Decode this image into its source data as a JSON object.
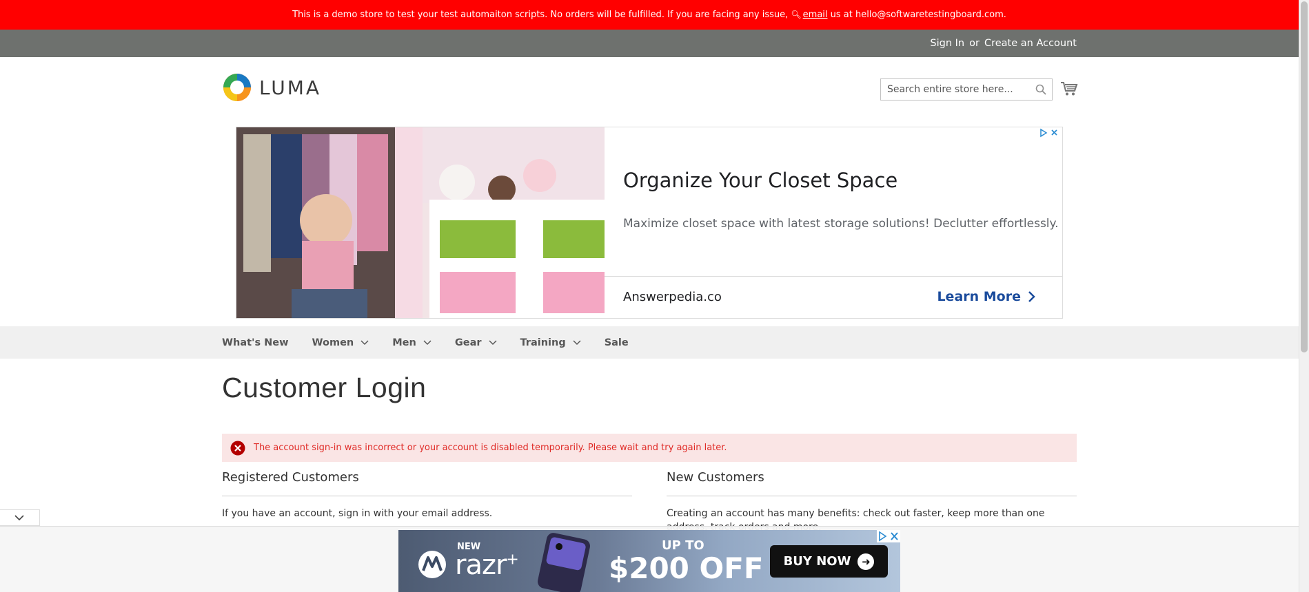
{
  "demo_notice": {
    "text_before": "This is a demo store to test your test automaiton scripts. No orders will be fulfilled. If you are facing any issue, ",
    "email_link": "email",
    "text_after": " us at hello@softwaretestingboard.com."
  },
  "header_links": {
    "sign_in": "Sign In",
    "or": "or",
    "create_account": "Create an Account"
  },
  "logo_text": "LUMA",
  "search": {
    "placeholder": "Search entire store here..."
  },
  "ad": {
    "title": "Organize Your Closet Space",
    "description": "Maximize closet space with latest storage solutions! Declutter effortlessly.",
    "domain": "Answerpedia.co",
    "cta": "Learn More"
  },
  "nav": {
    "whats_new": "What's New",
    "women": "Women",
    "men": "Men",
    "gear": "Gear",
    "training": "Training",
    "sale": "Sale"
  },
  "page_title": "Customer Login",
  "error_message": "The account sign-in was incorrect or your account is disabled temporarily. Please wait and try again later.",
  "registered": {
    "title": "Registered Customers",
    "text": "If you have an account, sign in with your email address."
  },
  "new_customers": {
    "title": "New Customers",
    "text": "Creating an account has many benefits: check out faster, keep more than one address, track orders and more."
  },
  "bottom_ad": {
    "new_label": "NEW",
    "product": "razr",
    "product_plus": "+",
    "up_to": "UP TO",
    "price": "$200 OFF",
    "cta": "BUY NOW"
  },
  "colors": {
    "demo_bar": "#ff0000",
    "panel_header": "#6e716e",
    "nav_bg": "#f0f0f0",
    "error_bg": "#fae5e5",
    "error_text": "#e02b27",
    "ad_cta": "#1a4b9c"
  }
}
